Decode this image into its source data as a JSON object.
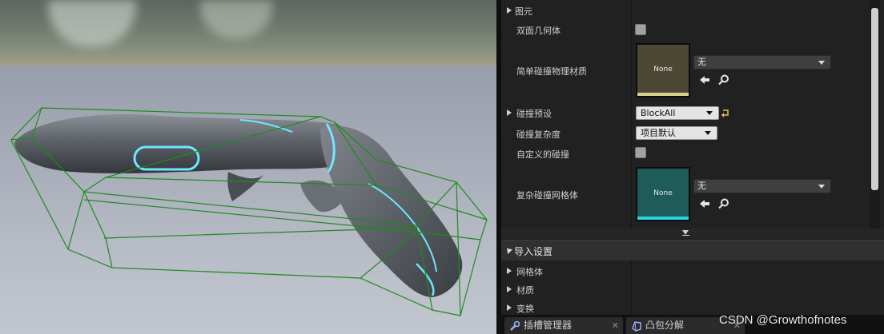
{
  "details": {
    "group_primitives": "图元",
    "double_sided_geometry": {
      "label": "双面几何体",
      "checked": false
    },
    "simple_collision_material": {
      "label": "简单碰撞物理材质",
      "thumb_text": "None",
      "value": "无"
    },
    "collision_presets": {
      "label": "碰撞预设",
      "value": "BlockAll"
    },
    "collision_complexity": {
      "label": "碰撞复杂度",
      "value": "项目默认"
    },
    "custom_collision": {
      "label": "自定义的碰撞",
      "checked": false
    },
    "complex_collision_mesh": {
      "label": "复杂碰撞网格体",
      "thumb_text": "None",
      "value": "无"
    }
  },
  "import_settings": {
    "title": "导入设置",
    "items": [
      "网格体",
      "材质",
      "变换"
    ]
  },
  "tabs": [
    {
      "label": "插槽管理器",
      "close": "✕"
    },
    {
      "label": "凸包分解",
      "close": "✕"
    }
  ],
  "watermark": "CSDN @Growthofnotes",
  "colors": {
    "panel_bg": "#212121",
    "collision_wire": "#1f8a1f",
    "controller_glow": "#6fe6ff",
    "material_thumb_1": "#4d4833",
    "material_thumb_2": "#1e5b5a"
  },
  "icons": [
    "reset-arrow-icon",
    "browse-arrow-icon",
    "search-icon",
    "wrench-icon",
    "hull-icon"
  ]
}
